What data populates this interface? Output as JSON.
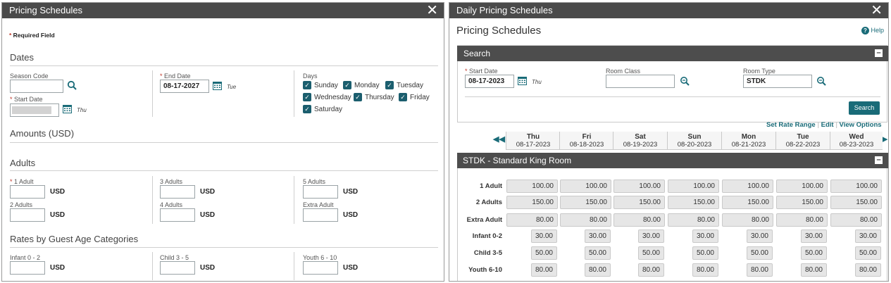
{
  "left": {
    "title": "Pricing Schedules",
    "required_note": "Required Field",
    "dates_title": "Dates",
    "season_code_label": "Season Code",
    "start_date_label": "Start Date",
    "start_day": "Thu",
    "end_date_label": "End Date",
    "end_date_value": "08-17-2027",
    "end_day": "Tue",
    "days_label": "Days",
    "days": [
      "Sunday",
      "Monday",
      "Tuesday",
      "Wednesday",
      "Thursday",
      "Friday",
      "Saturday"
    ],
    "amounts_title": "Amounts (USD)",
    "adults_title": "Adults",
    "adult_labels": [
      "1 Adult",
      "2 Adults",
      "3 Adults",
      "4 Adults",
      "5 Adults",
      "Extra Adult"
    ],
    "currency": "USD",
    "age_title": "Rates by Guest Age Categories",
    "age_labels": [
      "Infant 0 - 2",
      "Child 3 - 5",
      "Youth 6 - 10"
    ]
  },
  "right": {
    "title": "Daily Pricing Schedules",
    "page_title": "Pricing Schedules",
    "help": "Help",
    "search_title": "Search",
    "start_date_label": "Start Date",
    "start_date_value": "08-17-2023",
    "start_day": "Thu",
    "room_class_label": "Room Class",
    "room_type_label": "Room Type",
    "room_type_value": "STDK",
    "search_button": "Search",
    "links": [
      "Set Rate Range",
      "Edit",
      "View Options"
    ],
    "days": [
      {
        "day": "Thu",
        "date": "08-17-2023"
      },
      {
        "day": "Fri",
        "date": "08-18-2023"
      },
      {
        "day": "Sat",
        "date": "08-19-2023"
      },
      {
        "day": "Sun",
        "date": "08-20-2023"
      },
      {
        "day": "Mon",
        "date": "08-21-2023"
      },
      {
        "day": "Tue",
        "date": "08-22-2023"
      },
      {
        "day": "Wed",
        "date": "08-23-2023"
      }
    ],
    "room_title": "STDK - Standard King Room",
    "rows": [
      {
        "label": "1 Adult",
        "values": [
          "100.00",
          "100.00",
          "100.00",
          "100.00",
          "100.00",
          "100.00",
          "100.00"
        ]
      },
      {
        "label": "2 Adults",
        "values": [
          "150.00",
          "150.00",
          "150.00",
          "150.00",
          "150.00",
          "150.00",
          "150.00"
        ]
      },
      {
        "label": "Extra Adult",
        "values": [
          "80.00",
          "80.00",
          "80.00",
          "80.00",
          "80.00",
          "80.00",
          "80.00"
        ]
      },
      {
        "label": "Infant 0-2",
        "values": [
          "30.00",
          "30.00",
          "30.00",
          "30.00",
          "30.00",
          "30.00",
          "30.00"
        ]
      },
      {
        "label": "Child 3-5",
        "values": [
          "50.00",
          "50.00",
          "50.00",
          "50.00",
          "50.00",
          "50.00",
          "50.00"
        ]
      },
      {
        "label": "Youth 6-10",
        "values": [
          "80.00",
          "80.00",
          "80.00",
          "80.00",
          "80.00",
          "80.00",
          "80.00"
        ]
      }
    ]
  }
}
